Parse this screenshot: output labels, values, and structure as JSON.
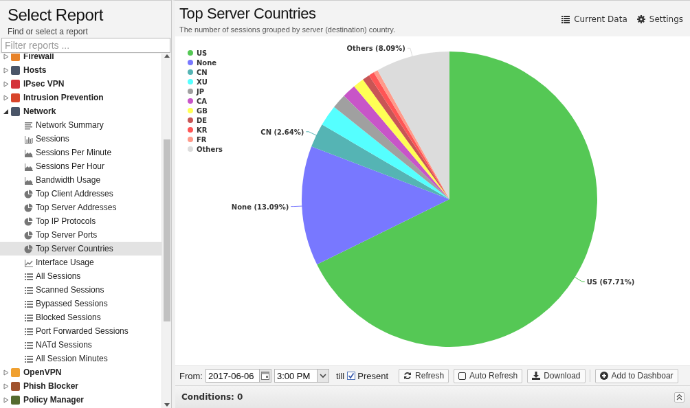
{
  "sidebar": {
    "title": "Select Report",
    "subtitle": "Find or select a report",
    "filter": {
      "placeholder": "Filter reports ..."
    },
    "groups": [
      {
        "label": "Firewall",
        "color": "#e8832a",
        "expanded": false
      },
      {
        "label": "Hosts",
        "color": "#4a5568",
        "expanded": false
      },
      {
        "label": "IPsec VPN",
        "color": "#d4323a",
        "expanded": false
      },
      {
        "label": "Intrusion Prevention",
        "color": "#d8452b",
        "expanded": false
      },
      {
        "label": "Network",
        "color": "#4a5568",
        "expanded": true,
        "children": [
          {
            "label": "Network Summary",
            "kind": "text",
            "selected": false
          },
          {
            "label": "Sessions",
            "kind": "bar",
            "selected": false
          },
          {
            "label": "Sessions Per Minute",
            "kind": "area",
            "selected": false
          },
          {
            "label": "Sessions Per Hour",
            "kind": "area",
            "selected": false
          },
          {
            "label": "Bandwidth Usage",
            "kind": "area",
            "selected": false
          },
          {
            "label": "Top Client Addresses",
            "kind": "pie",
            "selected": false
          },
          {
            "label": "Top Server Addresses",
            "kind": "pie",
            "selected": false
          },
          {
            "label": "Top IP Protocols",
            "kind": "pie",
            "selected": false
          },
          {
            "label": "Top Server Ports",
            "kind": "pie",
            "selected": false
          },
          {
            "label": "Top Server Countries",
            "kind": "pie",
            "selected": true
          },
          {
            "label": "Interface Usage",
            "kind": "line",
            "selected": false
          },
          {
            "label": "All Sessions",
            "kind": "list",
            "selected": false
          },
          {
            "label": "Scanned Sessions",
            "kind": "list",
            "selected": false
          },
          {
            "label": "Bypassed Sessions",
            "kind": "list",
            "selected": false
          },
          {
            "label": "Blocked Sessions",
            "kind": "list",
            "selected": false
          },
          {
            "label": "Port Forwarded Sessions",
            "kind": "list",
            "selected": false
          },
          {
            "label": "NATd Sessions",
            "kind": "list",
            "selected": false
          },
          {
            "label": "All Session Minutes",
            "kind": "list",
            "selected": false
          }
        ]
      },
      {
        "label": "OpenVPN",
        "color": "#f0a030",
        "expanded": false
      },
      {
        "label": "Phish Blocker",
        "color": "#a0522d",
        "expanded": false
      },
      {
        "label": "Policy Manager",
        "color": "#556b2f",
        "expanded": false
      }
    ]
  },
  "report": {
    "title": "Top Server Countries",
    "description": "The number of sessions grouped by server (destination) country.",
    "actions": [
      {
        "label": "Current Data",
        "kind": "data"
      },
      {
        "label": "Settings",
        "kind": "settings"
      }
    ],
    "chart_data": {
      "type": "pie",
      "categories": [
        "US",
        "None",
        "CN",
        "XU",
        "JP",
        "CA",
        "GB",
        "DE",
        "KR",
        "FR",
        "Others"
      ],
      "legend": true,
      "series": [
        {
          "values": [
            67.71,
            13.09,
            2.64,
            2.3,
            1.6,
            1.5,
            1.2,
            0.8,
            0.6,
            0.47,
            8.09
          ],
          "colors": [
            "#55c855",
            "#7878ff",
            "#55b4b4",
            "#55ffff",
            "#a0a0a0",
            "#c855c8",
            "#ffff55",
            "#c85555",
            "#ff5555",
            "#ff9a8a",
            "#dcdcdc"
          ]
        }
      ],
      "value_labels": [
        "US (67.71%)",
        "None (13.09%)",
        "CN (2.64%)",
        null,
        null,
        null,
        null,
        null,
        null,
        null,
        "Others (8.09%)"
      ]
    },
    "toolbar": {
      "from_label": "From:",
      "date": "2017-06-06",
      "time": "3:00 PM",
      "till_label": "till",
      "present": {
        "label": "Present",
        "checked": true
      },
      "buttons": [
        {
          "label": "Refresh",
          "kind": "refresh"
        },
        {
          "label": "Auto Refresh",
          "kind": "toggle",
          "checked": false
        },
        {
          "label": "Download",
          "kind": "download"
        },
        {
          "label": "Add to Dashboar",
          "kind": "add"
        }
      ]
    },
    "conditions": {
      "label": "Conditions: 0"
    }
  }
}
